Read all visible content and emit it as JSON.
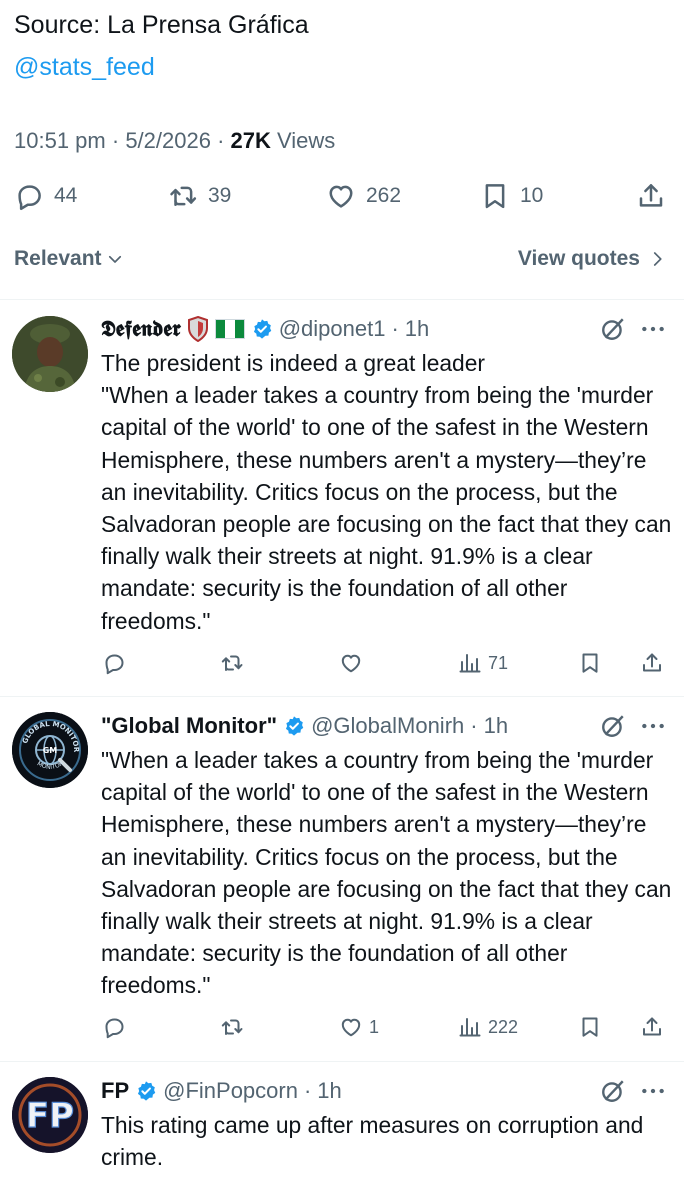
{
  "main_post": {
    "source_text": "Source: La Prensa Gráfica",
    "mention": "@stats_feed",
    "time": "10:51 pm",
    "sep1": "·",
    "date": "5/2/2026",
    "sep2": "·",
    "views_count": "27K",
    "views_label": "Views",
    "actions": {
      "replies": "44",
      "reposts": "39",
      "likes": "262",
      "bookmarks": "10"
    }
  },
  "filters": {
    "sort_label": "Relevant",
    "view_quotes_label": "View quotes"
  },
  "replies": [
    {
      "name": "𝕯𝖊𝖋𝖊𝖓𝖉𝖊𝖗",
      "handle": "@diponet1",
      "sep": "·",
      "time": "1h",
      "text": "The president is indeed a great leader\n\"When a leader takes a country from being the 'murder capital of the world' to one of the safest in the Western Hemisphere, these numbers aren't a mystery—they’re an inevitability. Critics focus on the process, but the Salvadoran people are focusing on the fact that they can finally walk their streets at night. 91.9% is a clear mandate: security is the foundation of all other freedoms.\"",
      "likes": "",
      "views": "71"
    },
    {
      "name": "\"Global Monitor\"",
      "handle": "@GlobalMonirh",
      "sep": "·",
      "time": "1h",
      "text": "\"When a leader takes a country from being the 'murder capital of the world' to one of the safest in the Western Hemisphere, these numbers aren't a mystery—they’re an inevitability. Critics focus on the process, but the Salvadoran people are focusing on the fact that they can finally walk their streets at night. 91.9% is a clear mandate: security is the foundation of all other freedoms.\"",
      "likes": "1",
      "views": "222",
      "avatar_text_top": "GLOBAL MONITOR",
      "avatar_text_mid": "GM",
      "avatar_text_bottom": "MONITOR"
    },
    {
      "name": "FP",
      "handle": "@FinPopcorn",
      "sep": "·",
      "time": "1h",
      "text": "This rating came up after measures on corruption and crime.",
      "avatar_text": "FP"
    }
  ],
  "colors": {
    "accent": "#1d9bf0",
    "secondary_text": "#536471",
    "divider": "#eff3f4"
  }
}
